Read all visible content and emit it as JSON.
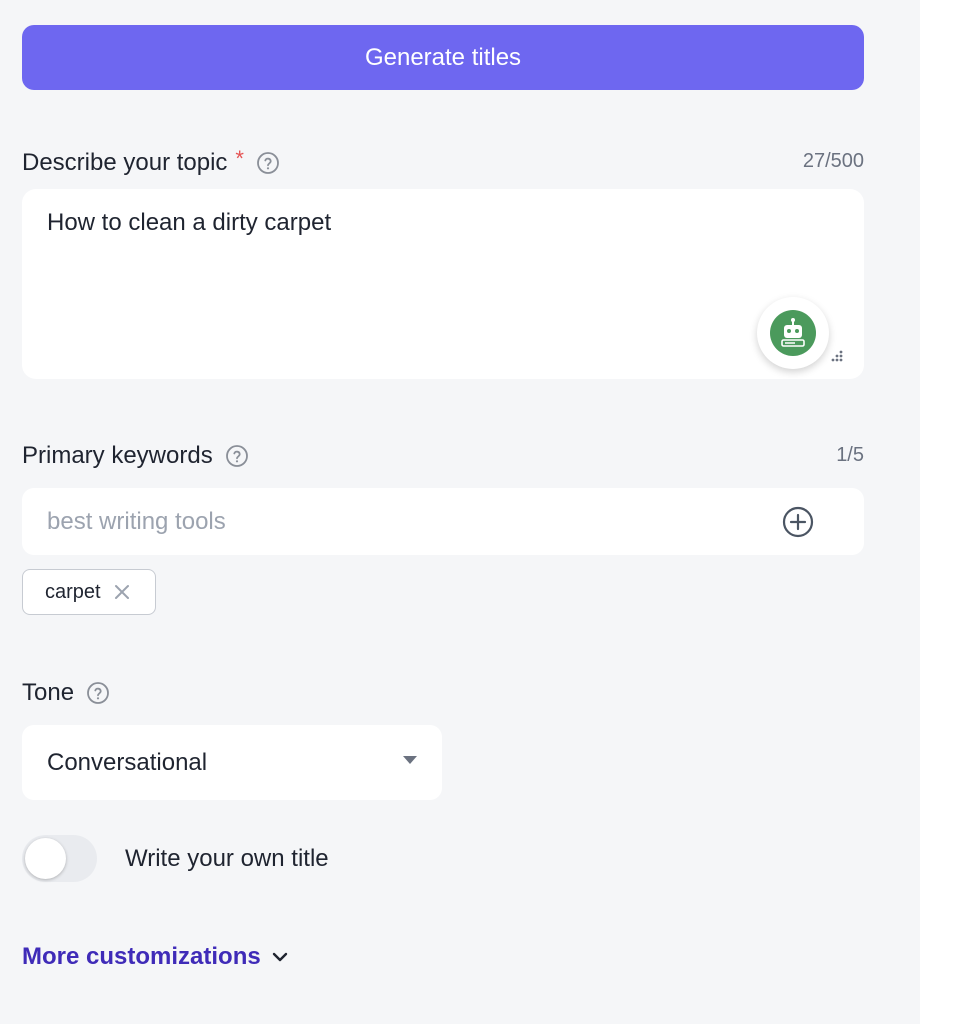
{
  "generate_button": {
    "label": "Generate titles"
  },
  "topic": {
    "label": "Describe your topic",
    "required_mark": "*",
    "counter": "27/500",
    "value": "How to clean a dirty carpet",
    "assistant_icon": "robot-icon"
  },
  "keywords": {
    "label": "Primary keywords",
    "counter": "1/5",
    "placeholder": "best writing tools",
    "add_icon": "plus-circle-icon",
    "chips": [
      {
        "label": "carpet"
      }
    ]
  },
  "tone": {
    "label": "Tone",
    "selected": "Conversational"
  },
  "own_title": {
    "label": "Write your own title",
    "enabled": false
  },
  "more_customizations": {
    "label": "More customizations"
  },
  "colors": {
    "primary_button": "#6e67f0",
    "link": "#3f2bb8",
    "required": "#e55353",
    "assistant_badge": "#4b9a5c",
    "panel_background": "#f5f6f8"
  }
}
